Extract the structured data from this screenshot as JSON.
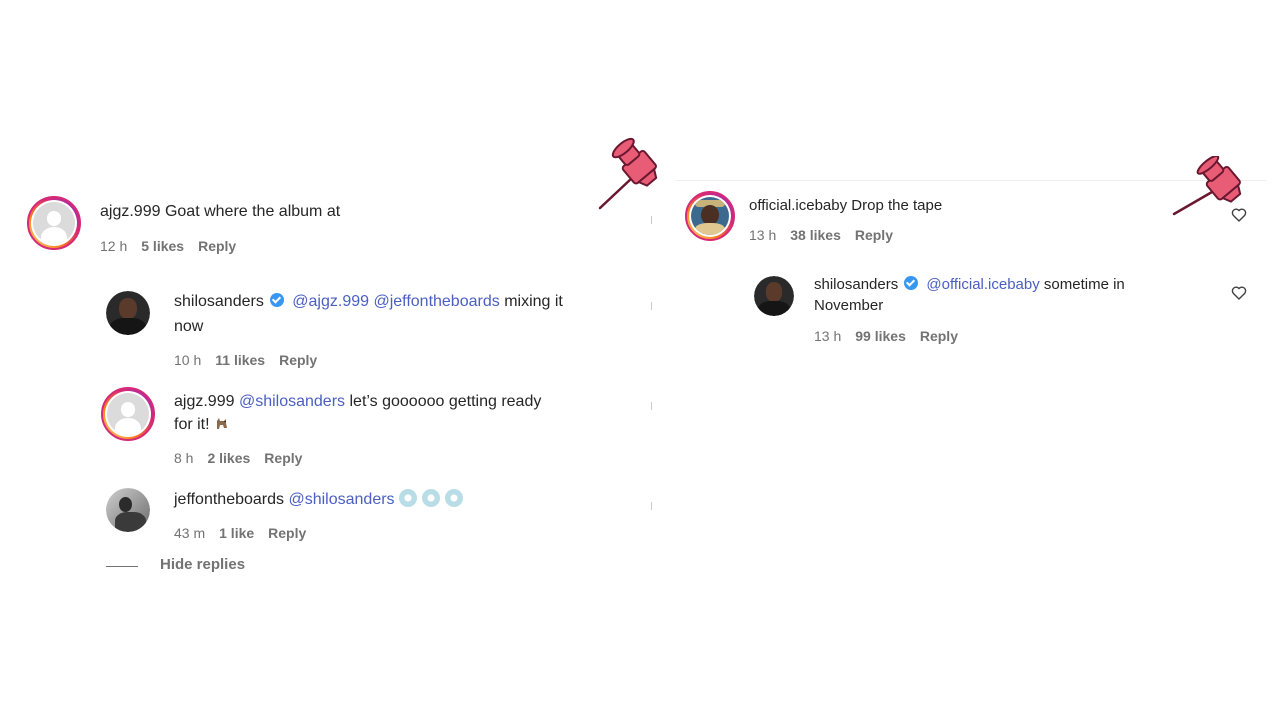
{
  "left_thread": {
    "main": {
      "username": "ajgz.999",
      "text": "Goat where the album at",
      "time": "12 h",
      "likes": "5 likes",
      "reply": "Reply"
    },
    "replies": [
      {
        "username": "shilosanders",
        "verified": true,
        "mention1": "@ajgz.999",
        "mention2": "@jeffontheboards",
        "text_a": "mixing it",
        "text_b": "now",
        "time": "10 h",
        "likes": "11 likes",
        "reply": "Reply"
      },
      {
        "username": "ajgz.999",
        "mention": "@shilosanders",
        "text_a": "let’s goooooo getting ready",
        "text_b": "for it!",
        "time": "8 h",
        "likes": "2 likes",
        "reply": "Reply"
      },
      {
        "username": "jeffontheboards",
        "mention": "@shilosanders",
        "time": "43 m",
        "likes": "1 like",
        "reply": "Reply"
      }
    ],
    "hide_replies": "Hide replies"
  },
  "right_thread": {
    "main": {
      "username": "official.icebaby",
      "text": "Drop the tape",
      "time": "13 h",
      "likes": "38 likes",
      "reply": "Reply"
    },
    "reply": {
      "username": "shilosanders",
      "verified": true,
      "mention": "@official.icebaby",
      "text_a": "sometime in",
      "text_b": "November",
      "time": "13 h",
      "likes": "99 likes",
      "reply": "Reply"
    }
  },
  "icons": [
    "pushpin-icon",
    "heart-icon",
    "verified-badge-icon",
    "default-avatar-icon",
    "goat-emoji",
    "disc-emoji"
  ],
  "colors": {
    "mention": "#4a5fc1",
    "meta_text": "#737373",
    "pin_fill": "#e85c75",
    "pin_outline": "#6a1730",
    "verified": "#3897f0",
    "story_ring": "#d62976"
  }
}
